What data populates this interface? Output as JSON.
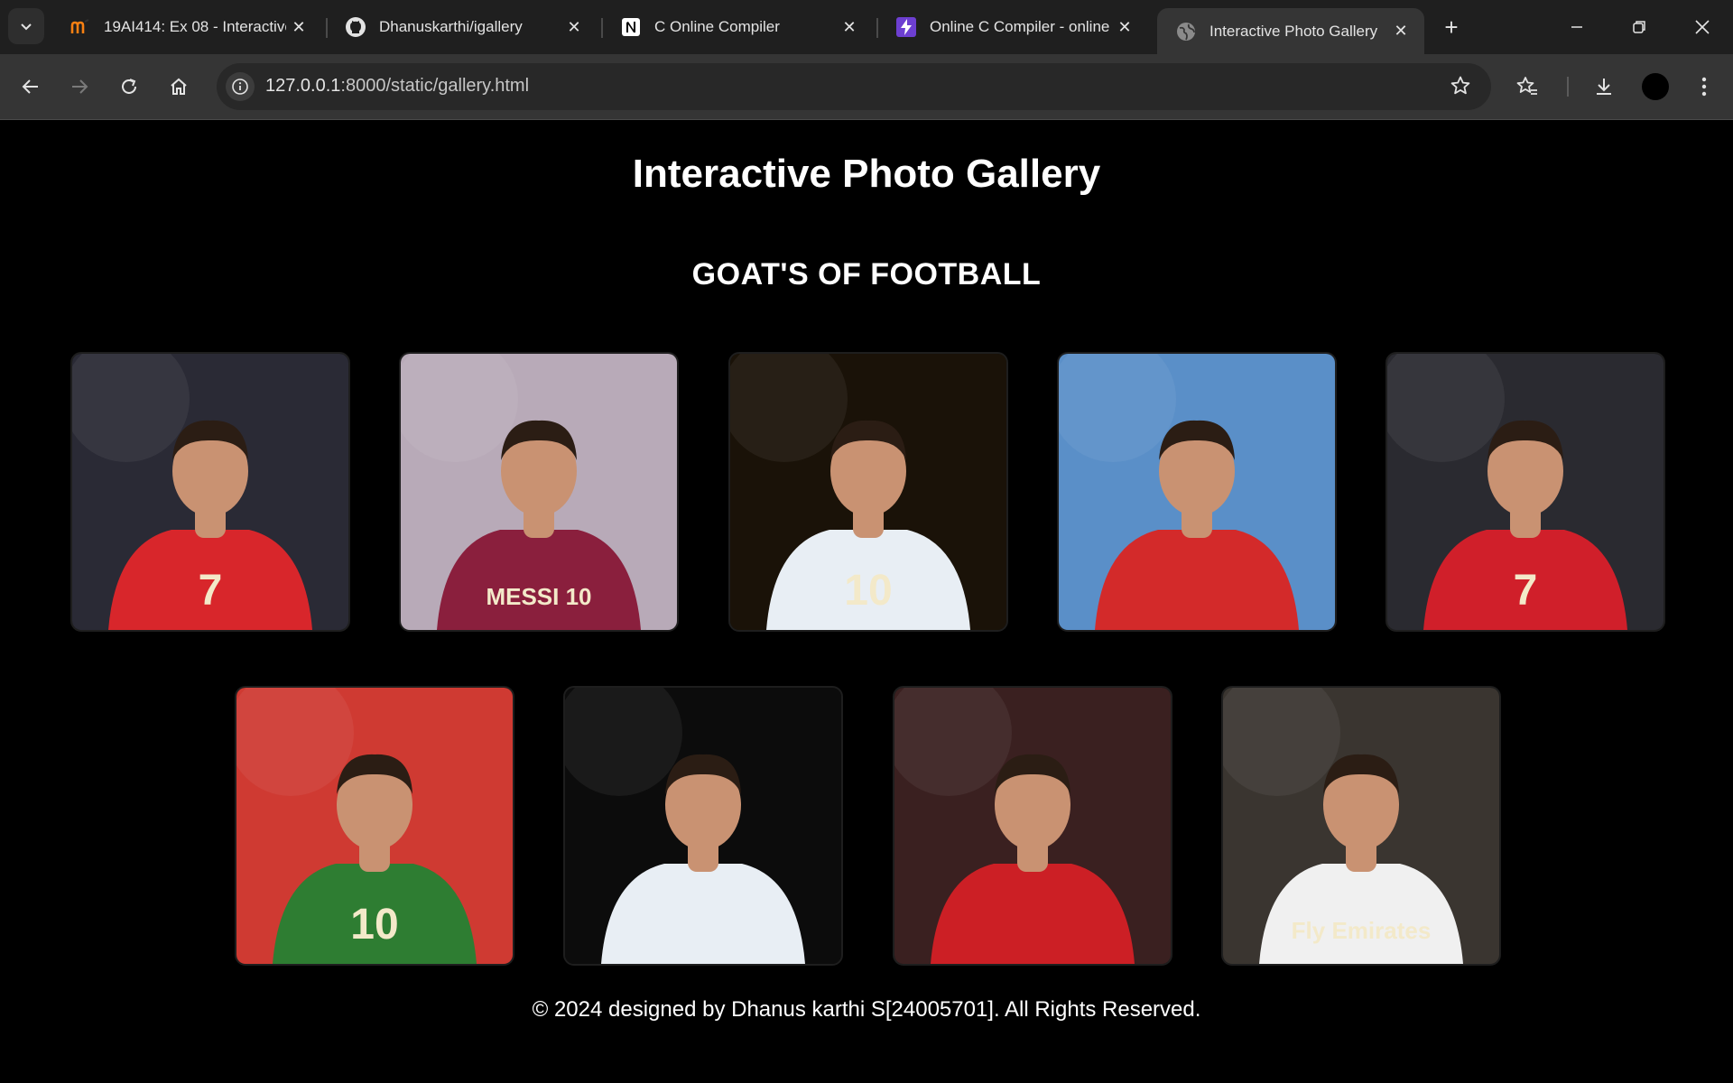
{
  "browser": {
    "tabs": [
      {
        "title": "19AI414: Ex 08 - Interactive",
        "icon": "moodle-icon"
      },
      {
        "title": "Dhanuskarthi/igallery",
        "icon": "github-icon"
      },
      {
        "title": "C Online Compiler",
        "icon": "notion-icon"
      },
      {
        "title": "Online C Compiler - online",
        "icon": "bolt-icon"
      },
      {
        "title": "Interactive Photo Gallery",
        "icon": "globe-icon",
        "active": true
      }
    ],
    "address": {
      "host": "127.0.0.1",
      "path": ":8000/static/gallery.html"
    }
  },
  "page": {
    "title": "Interactive Photo Gallery",
    "section_title": "GOAT'S OF FOOTBALL",
    "photos": [
      {
        "jersey_text": "7",
        "bg": "#2a2a35",
        "shirt": "#d8262b"
      },
      {
        "jersey_text": "MESSI 10",
        "bg": "#b8aab8",
        "shirt": "#8a1f3d"
      },
      {
        "jersey_text": "10",
        "bg": "#1a1208",
        "shirt": "#e8eef4"
      },
      {
        "jersey_text": "",
        "bg": "#5a8fc8",
        "shirt": "#d32a2a"
      },
      {
        "jersey_text": "7",
        "bg": "#2a2a30",
        "shirt": "#d01f2a"
      },
      {
        "jersey_text": "10",
        "bg": "#cf3a32",
        "shirt": "#2e7d32"
      },
      {
        "jersey_text": "",
        "bg": "#0c0c0c",
        "shirt": "#e8eef4"
      },
      {
        "jersey_text": "",
        "bg": "#3a2020",
        "shirt": "#cc1f25"
      },
      {
        "jersey_text": "Fly Emirates",
        "bg": "#3a3530",
        "shirt": "#f0f0f0"
      }
    ],
    "footer": "© 2024 designed by Dhanus karthi S[24005701]. All Rights Reserved."
  }
}
